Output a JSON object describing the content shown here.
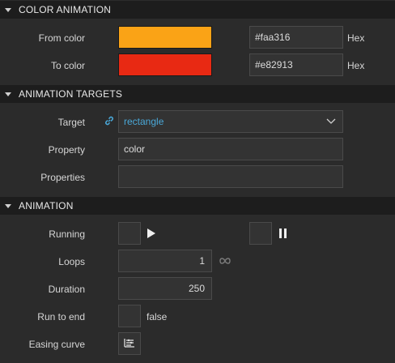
{
  "sections": {
    "color_animation": {
      "title": "COLOR ANIMATION",
      "from_label": "From color",
      "from_hex": "#faa316",
      "to_label": "To color",
      "to_hex": "#e82913",
      "hex_unit": "Hex"
    },
    "animation_targets": {
      "title": "ANIMATION TARGETS",
      "target_label": "Target",
      "target_value": "rectangle",
      "property_label": "Property",
      "property_value": "color",
      "properties_label": "Properties",
      "properties_value": ""
    },
    "animation": {
      "title": "ANIMATION",
      "running_label": "Running",
      "loops_label": "Loops",
      "loops_value": "1",
      "duration_label": "Duration",
      "duration_value": "250",
      "run_to_end_label": "Run to end",
      "run_to_end_value": "false",
      "easing_label": "Easing curve"
    }
  },
  "colors": {
    "from_color": "#faa316",
    "to_color": "#e82913",
    "link_accent": "#4aa8d8"
  },
  "icons": [
    "collapse-triangle-icon",
    "link-icon",
    "chevron-down-icon",
    "play-icon",
    "pause-icon",
    "infinity-icon",
    "easing-curve-icon"
  ]
}
